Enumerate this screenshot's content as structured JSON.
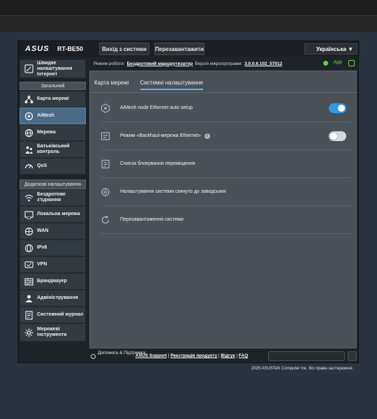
{
  "header": {
    "brand": "ASUS",
    "model": "RT-BE50",
    "logout_label": "Вихід з системи",
    "reboot_label": "Перезавантажити",
    "language": "Українська"
  },
  "status": {
    "mode_label": "Режим роботи:",
    "mode_value": "Бездротовий маршрутизатор",
    "firmware_label": "Версія мікропрограми:",
    "firmware_value": "3.0.0.6.102_57012",
    "app_label": "App"
  },
  "sidebar": {
    "quick_setup": "Швидке налаштування Інтернет",
    "general_header": "Загальний",
    "general_items": [
      "Карта мережі",
      "AiMesh",
      "Мережа",
      "Батьківський контроль",
      "QoS"
    ],
    "advanced_header": "Додаткові налаштування",
    "advanced_items": [
      "Бездротове з'єднання",
      "Локальна мережа",
      "WAN",
      "IPv6",
      "VPN",
      "Брандмауер",
      "Адміністрування",
      "Системний журнал",
      "Мережеві інструменти"
    ]
  },
  "tabs": [
    "Карта мережі",
    "Системні налаштування"
  ],
  "settings": [
    {
      "label": "AiMesh node Ethernet auto setup",
      "toggle": "on"
    },
    {
      "label": "Режим «Backhaul-мережа Ethernet»",
      "toggle": "off",
      "info": "i"
    },
    {
      "label": "Список блокування переміщення"
    },
    {
      "label": "Налаштування системи скинуто до заводських"
    },
    {
      "label": "Перезавантаження системи"
    }
  ],
  "footer": {
    "help": "Допомога & Підтримка",
    "links": [
      "ASUS Support",
      "Реєстрація продукту",
      "Відгук",
      "FAQ"
    ],
    "copyright": "2025 ASUSTeK Computer Inc. Всі права застережені."
  },
  "colors": {
    "accent": "#2f9ae8",
    "active_nav": "#4a6a87",
    "app_green": "#66d13e"
  }
}
